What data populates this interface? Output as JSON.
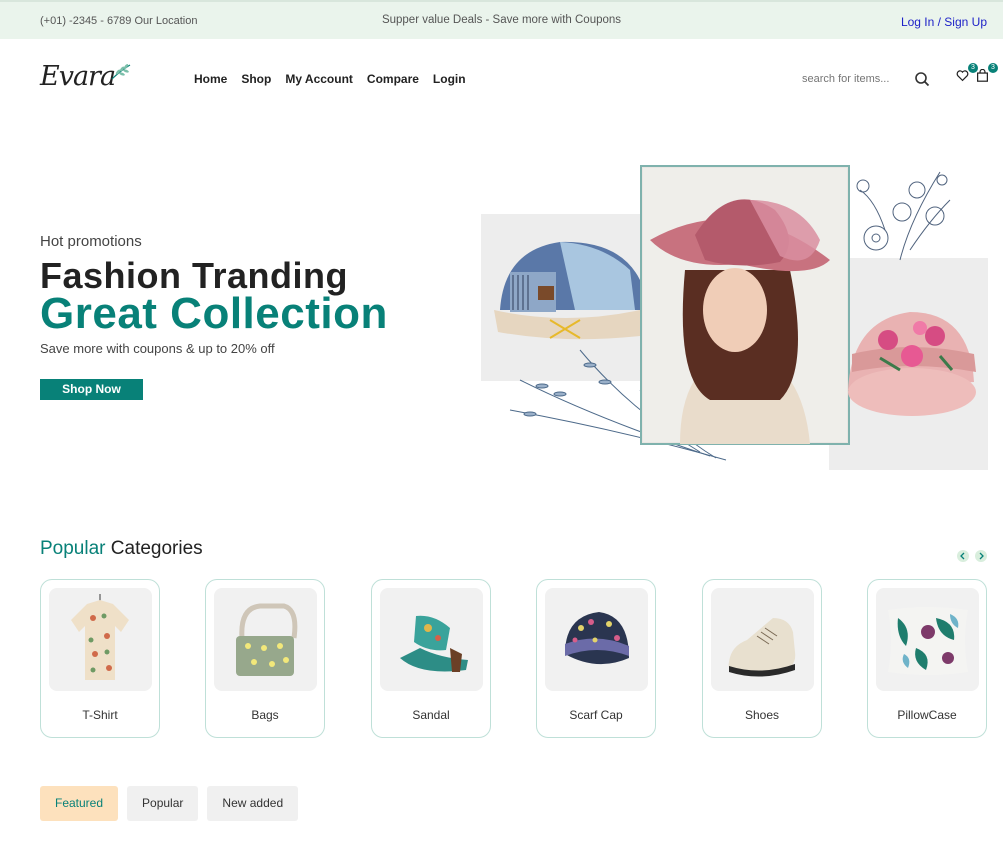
{
  "topbar": {
    "phone": "(+01) -2345 - 6789 Our Location",
    "deal": "Supper value Deals - Save more with Coupons",
    "login": "Log In / Sign Up"
  },
  "header": {
    "logo": "Evara",
    "nav": [
      "Home",
      "Shop",
      "My Account",
      "Compare",
      "Login"
    ],
    "search_placeholder": "search for items...",
    "wishlist_count": "3",
    "cart_count": "3"
  },
  "hero": {
    "subtitle": "Hot promotions",
    "title": "Fashion Tranding",
    "title2": "Great Collection",
    "description": "Save more with coupons & up to 20% off",
    "button": "Shop Now"
  },
  "categories": {
    "title_accent": "Popular",
    "title_rest": " Categories",
    "items": [
      {
        "label": "T-Shirt",
        "icon": "tshirt-image"
      },
      {
        "label": "Bags",
        "icon": "bag-image"
      },
      {
        "label": "Sandal",
        "icon": "sandal-image"
      },
      {
        "label": "Scarf Cap",
        "icon": "scarf-cap-image"
      },
      {
        "label": "Shoes",
        "icon": "shoe-image"
      },
      {
        "label": "PillowCase",
        "icon": "pillowcase-image"
      }
    ]
  },
  "tabs": [
    "Featured",
    "Popular",
    "New added"
  ],
  "colors": {
    "accent": "#088178",
    "topbar_bg": "#eaf4ec",
    "active_tab_bg": "#fde1bd"
  }
}
